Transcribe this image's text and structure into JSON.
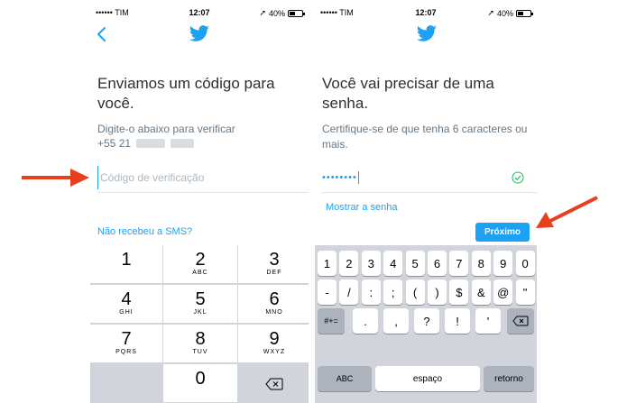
{
  "left_screen": {
    "status": {
      "carrier": "•••••• TIM",
      "time": "12:07",
      "battery": "40%"
    },
    "title": "Enviamos um código para você.",
    "subtitle": "Digite-o abaixo para verificar",
    "phone_prefix": "+55 21",
    "code_placeholder": "Código de verificação",
    "sms_link": "Não recebeu a SMS?",
    "keypad": [
      {
        "digit": "1",
        "letters": ""
      },
      {
        "digit": "2",
        "letters": "ABC"
      },
      {
        "digit": "3",
        "letters": "DEF"
      },
      {
        "digit": "4",
        "letters": "GHI"
      },
      {
        "digit": "5",
        "letters": "JKL"
      },
      {
        "digit": "6",
        "letters": "MNO"
      },
      {
        "digit": "7",
        "letters": "PQRS"
      },
      {
        "digit": "8",
        "letters": "TUV"
      },
      {
        "digit": "9",
        "letters": "WXYZ"
      },
      {
        "digit": "0",
        "letters": ""
      }
    ]
  },
  "right_screen": {
    "status": {
      "carrier": "•••••• TIM",
      "time": "12:07",
      "battery": "40%"
    },
    "title": "Você vai precisar de uma senha.",
    "subtitle": "Certifique-se de que tenha 6 caracteres ou mais.",
    "password_mask": "••••••••",
    "show_password": "Mostrar a senha",
    "next_button": "Próximo",
    "keyboard": {
      "row1": [
        "1",
        "2",
        "3",
        "4",
        "5",
        "6",
        "7",
        "8",
        "9",
        "0"
      ],
      "row2": [
        "-",
        "/",
        ":",
        ";",
        "(",
        ")",
        "$",
        "&",
        "@",
        "\""
      ],
      "symbols_key": "#+=",
      "row3": [
        ".",
        ",",
        "?",
        "!",
        "'"
      ],
      "abc_key": "ABC",
      "space_key": "espaço",
      "return_key": "retorno"
    }
  },
  "colors": {
    "accent": "#1da1f2",
    "arrow": "#e8401c",
    "keyboard_bg": "#d1d5db"
  }
}
